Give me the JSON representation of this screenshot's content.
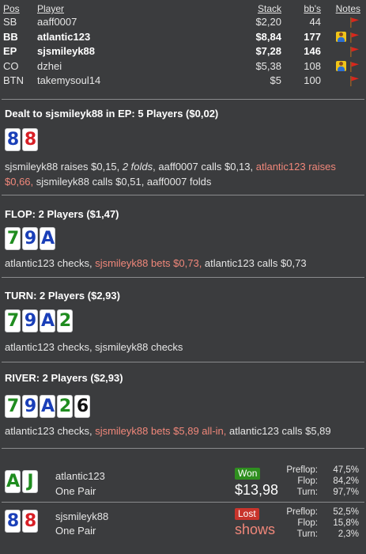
{
  "colors": {
    "background": "#3b3c3e",
    "text": "#e6e6e6",
    "highlight": "#f0877a",
    "card_red": "#d81f26",
    "card_blue": "#1a3fb8",
    "card_green": "#1f8c1f",
    "card_black": "#111111",
    "won_badge": "#2f8f1f",
    "lost_badge": "#c8342c",
    "flag": "#d9261c"
  },
  "players_table": {
    "headers": {
      "pos": "Pos",
      "player": "Player",
      "stack": "Stack",
      "bbs": "bb's",
      "notes": "Notes"
    },
    "rows": [
      {
        "pos": "SB",
        "player": "aaff0007",
        "stack": "$2,20",
        "bbs": "44",
        "icons": [
          "flag-icon"
        ]
      },
      {
        "pos": "BB",
        "player": "atlantic123",
        "stack": "$8,84",
        "bbs": "177",
        "icons": [
          "avatar-icon",
          "flag-icon"
        ]
      },
      {
        "pos": "EP",
        "player": "sjsmileyk88",
        "stack": "$7,28",
        "bbs": "146",
        "icons": [
          "flag-icon"
        ]
      },
      {
        "pos": "CO",
        "player": "dzhei",
        "stack": "$5,38",
        "bbs": "108",
        "icons": [
          "avatar-icon",
          "flag-icon"
        ]
      },
      {
        "pos": "BTN",
        "player": "takemysoul14",
        "stack": "$5",
        "bbs": "100",
        "icons": [
          "flag-icon"
        ]
      }
    ]
  },
  "preflop": {
    "title": "Dealt to sjsmileyk88 in EP: 5 Players ($0,02)",
    "cards": [
      {
        "rank": "8",
        "suit_color": "blue"
      },
      {
        "rank": "8",
        "suit_color": "red"
      }
    ],
    "actions": {
      "a1": "sjsmileyk88 raises $0,15, ",
      "a2": "2 folds",
      "a3": ", aaff0007 calls $0,13, ",
      "a4": "atlantic123 raises $0,66,",
      "a5": " sjsmileyk88 calls $0,51, aaff0007 folds"
    }
  },
  "flop": {
    "title": "FLOP: 2 Players ($1,47)",
    "cards": [
      {
        "rank": "7",
        "suit_color": "green"
      },
      {
        "rank": "9",
        "suit_color": "blue"
      },
      {
        "rank": "A",
        "suit_color": "blue"
      }
    ],
    "actions": {
      "a1": "atlantic123 checks, ",
      "a2": "sjsmileyk88 bets $0,73,",
      "a3": " atlantic123 calls $0,73"
    }
  },
  "turn": {
    "title": "TURN: 2 Players ($2,93)",
    "cards": [
      {
        "rank": "7",
        "suit_color": "green"
      },
      {
        "rank": "9",
        "suit_color": "blue"
      },
      {
        "rank": "A",
        "suit_color": "blue"
      },
      {
        "rank": "2",
        "suit_color": "green"
      }
    ],
    "actions": {
      "a1": "atlantic123 checks, sjsmileyk88 checks"
    }
  },
  "river": {
    "title": "RIVER: 2 Players ($2,93)",
    "cards": [
      {
        "rank": "7",
        "suit_color": "green"
      },
      {
        "rank": "9",
        "suit_color": "blue"
      },
      {
        "rank": "A",
        "suit_color": "blue"
      },
      {
        "rank": "2",
        "suit_color": "green"
      },
      {
        "rank": "6",
        "suit_color": "black"
      }
    ],
    "actions": {
      "a1": "atlantic123 checks, ",
      "a2": "sjsmileyk88 bets $5,89 all-in,",
      "a3": " atlantic123 calls $5,89"
    }
  },
  "results": [
    {
      "cards": [
        {
          "rank": "A",
          "suit_color": "green"
        },
        {
          "rank": "J",
          "suit_color": "green"
        }
      ],
      "player": "atlantic123",
      "hand": "One Pair",
      "badge": "Won",
      "amount": "$13,98",
      "equity": [
        {
          "label": "Preflop:",
          "value": "47,5%"
        },
        {
          "label": "Flop:",
          "value": "84,2%"
        },
        {
          "label": "Turn:",
          "value": "97,7%"
        }
      ]
    },
    {
      "cards": [
        {
          "rank": "8",
          "suit_color": "blue"
        },
        {
          "rank": "8",
          "suit_color": "red"
        }
      ],
      "player": "sjsmileyk88",
      "hand": "One Pair",
      "badge": "Lost",
      "amount": "shows",
      "equity": [
        {
          "label": "Preflop:",
          "value": "52,5%"
        },
        {
          "label": "Flop:",
          "value": "15,8%"
        },
        {
          "label": "Turn:",
          "value": "2,3%"
        }
      ]
    }
  ]
}
